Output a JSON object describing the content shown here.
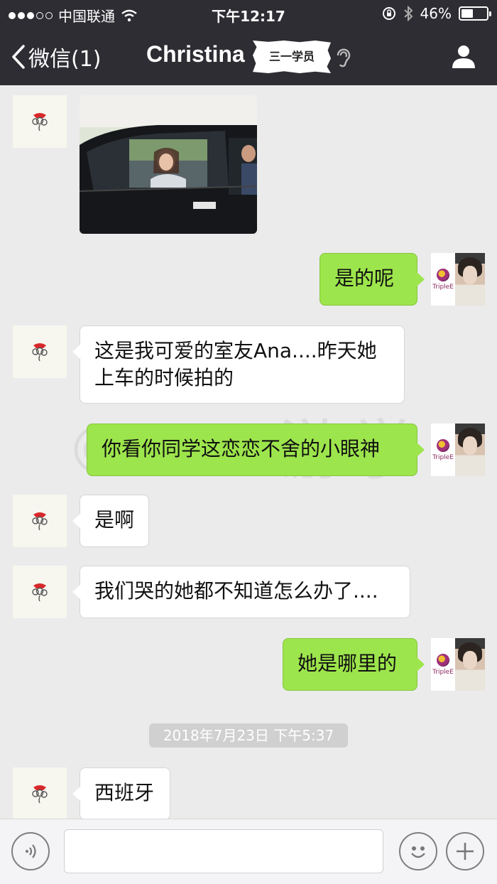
{
  "status_bar": {
    "carrier": "中国联通",
    "time": "下午12:17",
    "battery_percent": "46%",
    "battery_level": 0.46
  },
  "nav": {
    "back_label": "微信(1)",
    "title": "Christina",
    "tag": "三一学员"
  },
  "messages": [
    {
      "side": "in",
      "type": "image"
    },
    {
      "side": "out",
      "text": "是的呢"
    },
    {
      "side": "in",
      "text_line1": "这是我可爱的室友Ana....昨天她",
      "text_line2": "上车的时候拍的"
    },
    {
      "side": "out",
      "text": "你看你同学这恋恋不舍的小眼神"
    },
    {
      "side": "in",
      "text": "是啊"
    },
    {
      "side": "in",
      "text": "我们哭的她都不知道怎么办了...."
    },
    {
      "side": "out",
      "text": "她是哪里的"
    },
    {
      "side": "in",
      "text": "西班牙"
    }
  ],
  "timestamp": "2018年7月23日 下午5:37",
  "watermark": "©三一游学",
  "avatar_right_logo_text": "TripleE",
  "icons": {
    "voice": "voice-icon",
    "emoji": "emoji-icon",
    "add": "plus-icon",
    "profile": "profile-icon",
    "ear": "ear-icon",
    "back": "chevron-left-icon"
  },
  "colors": {
    "navbar": "#2e2d33",
    "chat_bg": "#ebebeb",
    "outgoing_bubble": "#9de54c",
    "incoming_bubble": "#ffffff"
  }
}
